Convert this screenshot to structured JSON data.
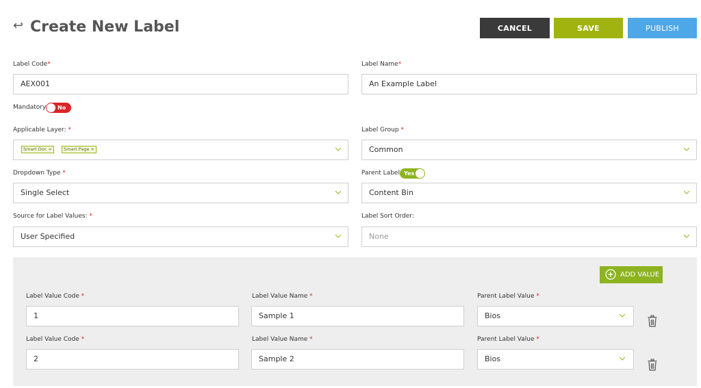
{
  "header": {
    "back_icon": "↩",
    "title": "Create New Label",
    "cancel_label": "CANCEL",
    "save_label": "SAVE",
    "publish_label": "PUBLISH"
  },
  "form": {
    "label_code": {
      "label": "Label Code",
      "value": "AEX001"
    },
    "label_name": {
      "label": "Label Name",
      "value": "An Example Label"
    },
    "mandatory": {
      "label": "Mandatory",
      "toggle_text": "No"
    },
    "applicable_layer": {
      "label": "Applicable Layer:",
      "tags": [
        "Smart Doc ×",
        "Smart Page ×"
      ]
    },
    "label_group": {
      "label": "Label Group",
      "value": "Common"
    },
    "dropdown_type": {
      "label": "Dropdown Type",
      "value": "Single Select"
    },
    "parent_label": {
      "label": "Parent Label",
      "toggle_text": "Yes",
      "value": "Content Bin"
    },
    "source_values": {
      "label": "Source for Label Values:",
      "value": "User Specified"
    },
    "sort_order": {
      "label": "Label Sort Order:",
      "value": "None"
    }
  },
  "required_mark": "*",
  "values_panel": {
    "add_value_label": "ADD VALUE",
    "col_code": "Label Value Code",
    "col_name": "Label Value Name",
    "col_parent": "Parent Label Value",
    "rows": [
      {
        "code": "1",
        "name": "Sample 1",
        "parent": "Bios"
      },
      {
        "code": "2",
        "name": "Sample 2",
        "parent": "Bios"
      }
    ]
  },
  "colors": {
    "cancel": "#3a3a3a",
    "save": "#a0b30e",
    "publish": "#4ea8e8",
    "toggle_no": "#d9252a",
    "toggle_yes": "#8db320",
    "required": "#d9252a"
  }
}
